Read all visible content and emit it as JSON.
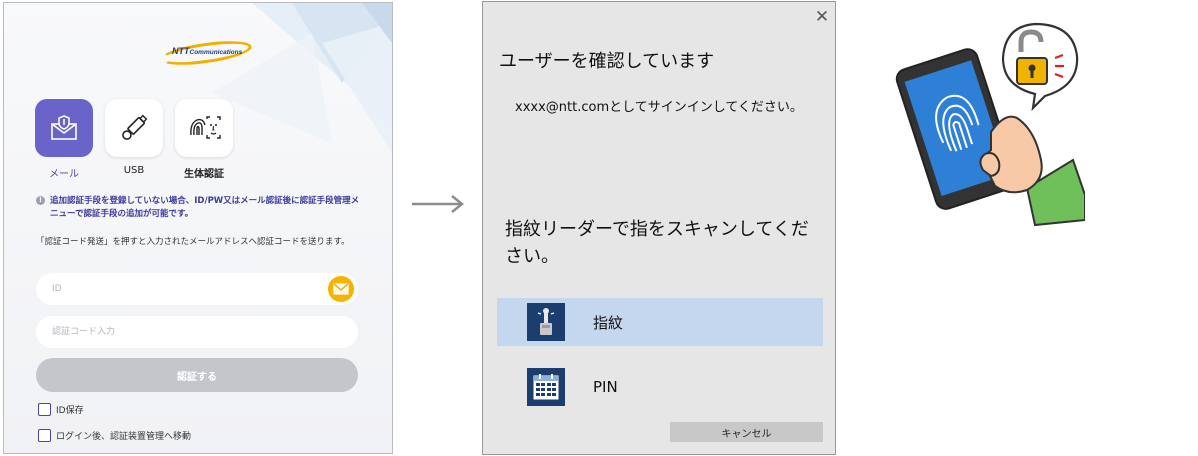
{
  "login": {
    "logo_main": "NTT",
    "logo_sub": "Communications",
    "methods": [
      {
        "label": "メール",
        "icon": "mail-shield-icon",
        "active": true
      },
      {
        "label": "USB",
        "icon": "usb-key-icon",
        "active": false
      },
      {
        "label": "生体認証",
        "icon": "fingerprint-face-scan-icon",
        "active": false
      }
    ],
    "notice": "追加認証手段を登録していない場合、ID/PW又はメール認証後に認証手段管理メニューで認証手段の追加が可能です。",
    "instruction": "「認証コード発送」を押すと入力されたメールアドレスへ認証コードを送ります。",
    "id_placeholder": "ID",
    "code_placeholder": "認証コード入力",
    "submit_label": "認証する",
    "checkbox_save_id": "ID保存",
    "checkbox_after_login": "ログイン後、認証装置管理へ移動"
  },
  "dialog": {
    "title": "ユーザーを確認しています",
    "account_text": "xxxx@ntt.comとしてサインインしてください。",
    "prompt": "指紋リーダーで指をスキャンしてください。",
    "options": [
      {
        "label": "指紋",
        "icon": "fingerprint-reader-icon",
        "selected": true
      },
      {
        "label": "PIN",
        "icon": "pin-keypad-icon",
        "selected": false
      }
    ],
    "cancel_label": "キャンセル"
  },
  "colors": {
    "accent": "#6a63c9",
    "dialog_selected": "#c5d7ee",
    "mail_badge": "#f5b400",
    "lock": "#f0b400"
  }
}
